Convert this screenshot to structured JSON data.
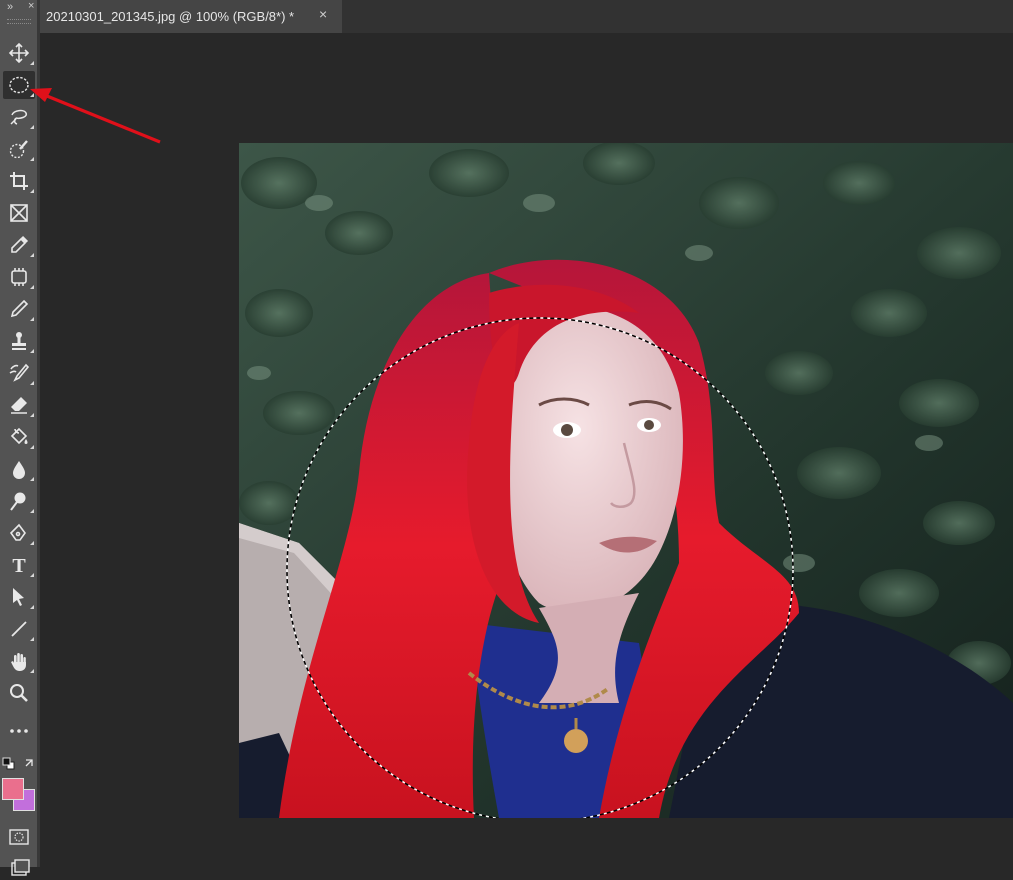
{
  "document_tab": {
    "title": "20210301_201345.jpg @ 100% (RGB/8*) *",
    "close_glyph": "×"
  },
  "toolbar": {
    "expand_glyph": "»",
    "close_glyph": "×",
    "active_tool": "elliptical-marquee-tool",
    "tools": [
      "move-tool-icon",
      "elliptical-marquee-icon",
      "lasso-tool-icon",
      "quick-selection-icon",
      "crop-tool-icon",
      "frame-tool-icon",
      "eyedropper-icon",
      "patch-tool-icon",
      "brush-tool-icon",
      "clone-stamp-icon",
      "history-brush-icon",
      "eraser-icon",
      "paint-bucket-icon",
      "blur-drop-icon",
      "dodge-tool-icon",
      "pen-tool-icon",
      "type-tool-icon",
      "path-selection-icon",
      "line-tool-icon",
      "hand-tool-icon",
      "zoom-tool-icon",
      "more-tools-icon"
    ],
    "type_glyph": "T"
  },
  "colors": {
    "foreground": "#ea6f8d",
    "background": "#c26fdc",
    "arrow": "#e0101a"
  }
}
